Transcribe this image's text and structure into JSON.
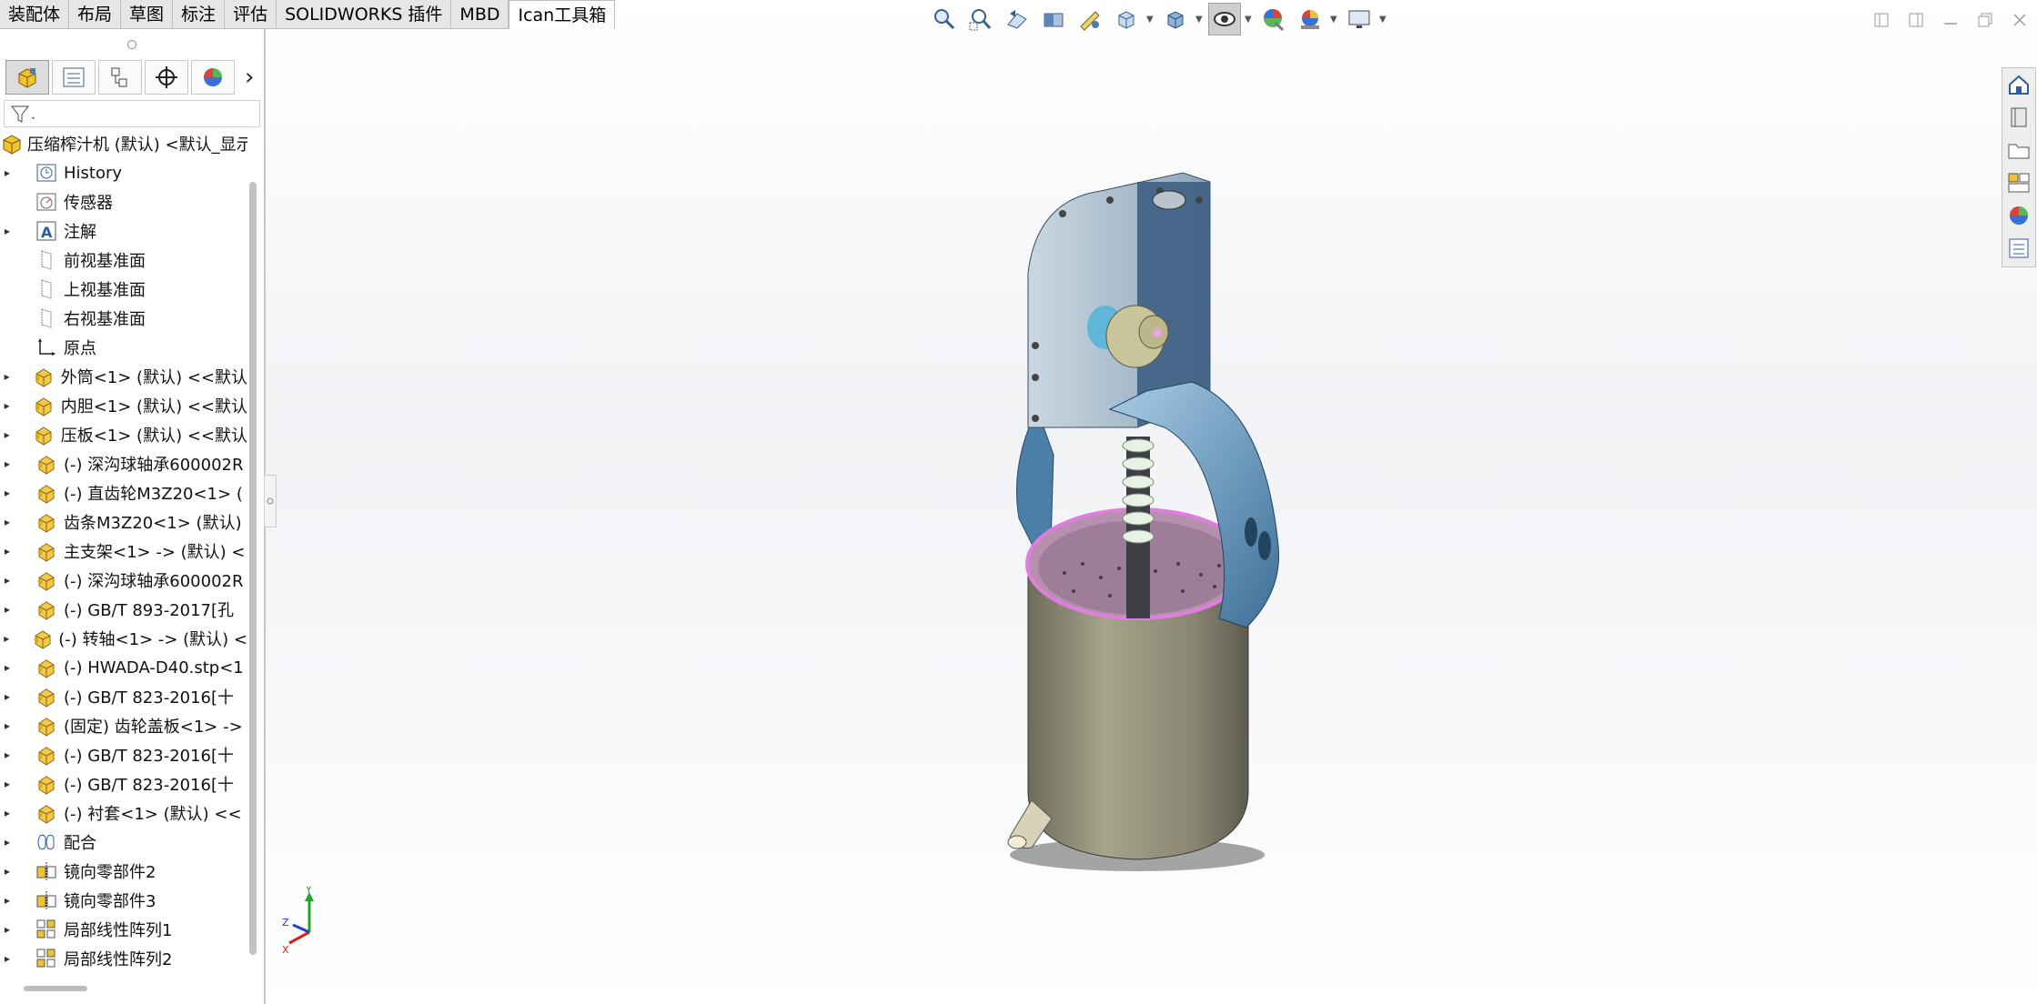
{
  "tabs": [
    "装配体",
    "布局",
    "草图",
    "标注",
    "评估",
    "SOLIDWORKS 插件",
    "MBD",
    "Ican工具箱"
  ],
  "hud_icons": [
    "zoom-to-fit-icon",
    "zoom-area-icon",
    "previous-view-icon",
    "section-view-icon",
    "dynamic-annotation-icon",
    "view-orientation-icon",
    "display-style-icon",
    "hide-show-items-icon",
    "edit-appearance-icon",
    "apply-scene-icon",
    "view-settings-icon"
  ],
  "window_icons": [
    "tile-left-icon",
    "tile-right-icon",
    "minimize-icon",
    "restore-icon",
    "close-icon"
  ],
  "panel_tabs": [
    "featuremanager-icon",
    "propertymanager-icon",
    "configurationmanager-icon",
    "dimxpertmanager-icon",
    "displaymanager-icon"
  ],
  "tree": [
    {
      "label": "压缩榨汁机 (默认) <默认_显示",
      "icon": "assembly-icon",
      "arrow": ""
    },
    {
      "label": "History",
      "icon": "history-icon",
      "arrow": "▸"
    },
    {
      "label": "传感器",
      "icon": "sensor-icon",
      "arrow": ""
    },
    {
      "label": "注解",
      "icon": "annotation-icon",
      "arrow": "▸"
    },
    {
      "label": "前视基准面",
      "icon": "plane-icon",
      "arrow": ""
    },
    {
      "label": "上视基准面",
      "icon": "plane-icon",
      "arrow": ""
    },
    {
      "label": "右视基准面",
      "icon": "plane-icon",
      "arrow": ""
    },
    {
      "label": "原点",
      "icon": "origin-icon",
      "arrow": ""
    },
    {
      "label": "外筒<1> (默认) <<默认",
      "icon": "part-icon",
      "arrow": "▸"
    },
    {
      "label": "内胆<1> (默认) <<默认",
      "icon": "part-icon",
      "arrow": "▸"
    },
    {
      "label": "压板<1> (默认) <<默认",
      "icon": "part-icon",
      "arrow": "▸"
    },
    {
      "label": "(-) 深沟球轴承600002R",
      "icon": "part-icon",
      "arrow": "▸"
    },
    {
      "label": "(-) 直齿轮M3Z20<1> (",
      "icon": "part-icon",
      "arrow": "▸"
    },
    {
      "label": "齿条M3Z20<1> (默认)",
      "icon": "part-icon",
      "arrow": "▸"
    },
    {
      "label": "主支架<1> -> (默认) <",
      "icon": "part-icon",
      "arrow": "▸"
    },
    {
      "label": "(-) 深沟球轴承600002R",
      "icon": "part-icon",
      "arrow": "▸"
    },
    {
      "label": "(-) GB/T 893-2017[孔",
      "icon": "part-icon",
      "arrow": "▸"
    },
    {
      "label": "(-) 转轴<1> -> (默认) <",
      "icon": "part-icon",
      "arrow": "▸"
    },
    {
      "label": "(-) HWADA-D40.stp<1",
      "icon": "part-icon",
      "arrow": "▸"
    },
    {
      "label": "(-) GB/T 823-2016[十",
      "icon": "part-icon",
      "arrow": "▸"
    },
    {
      "label": "(固定) 齿轮盖板<1> ->",
      "icon": "part-icon",
      "arrow": "▸"
    },
    {
      "label": "(-) GB/T 823-2016[十",
      "icon": "part-icon",
      "arrow": "▸"
    },
    {
      "label": "(-) GB/T 823-2016[十",
      "icon": "part-icon",
      "arrow": "▸"
    },
    {
      "label": "(-) 衬套<1> (默认) <<",
      "icon": "part-icon",
      "arrow": "▸"
    },
    {
      "label": "配合",
      "icon": "mates-icon",
      "arrow": "▸"
    },
    {
      "label": "镜向零部件2",
      "icon": "mirror-component-icon",
      "arrow": "▸"
    },
    {
      "label": "镜向零部件3",
      "icon": "mirror-component-icon",
      "arrow": "▸"
    },
    {
      "label": "局部线性阵列1",
      "icon": "linear-pattern-icon",
      "arrow": "▸"
    },
    {
      "label": "局部线性阵列2",
      "icon": "linear-pattern-icon",
      "arrow": "▸"
    }
  ],
  "task_pane": [
    "solidworks-resources-icon",
    "design-library-icon",
    "file-explorer-icon",
    "view-palette-icon",
    "appearances-icon",
    "custom-properties-icon"
  ],
  "triad": {
    "x": "X",
    "y": "Y",
    "z": "Z"
  }
}
